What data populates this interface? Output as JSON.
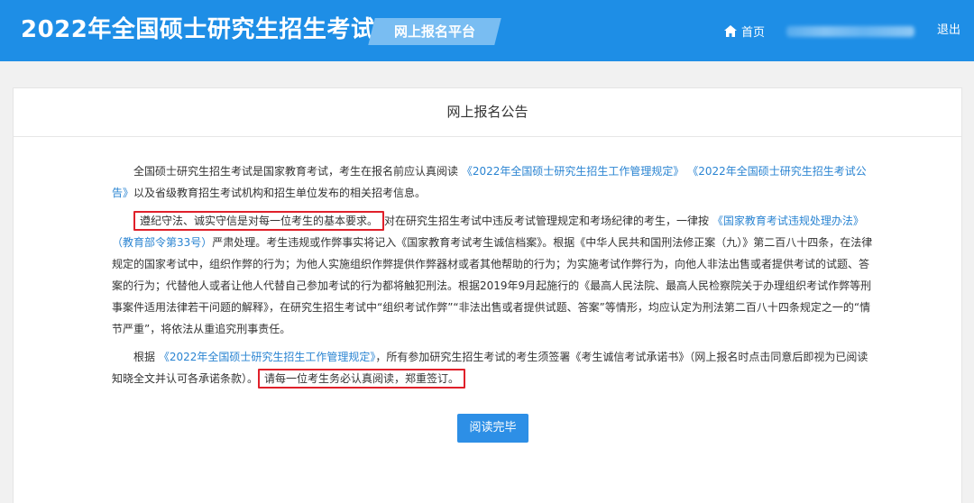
{
  "header": {
    "title": "2022年全国硕士研究生招生考试",
    "platform_badge": "网上报名平台",
    "nav": {
      "home_icon": "home-icon",
      "home_label": "首页",
      "logout_label": "退出"
    }
  },
  "panel": {
    "title": "网上报名公告",
    "paragraphs": [
      {
        "p1_a": "全国硕士研究生招生考试是国家教育考试，考生在报名前应认真阅读",
        "p1_link1": "《2022年全国硕士研究生招生工作管理规定》",
        "p1_link2": "《2022年全国硕士研究生招生考试公告》",
        "p1_b": "以及省级教育招生考试机构和招生单位发布的相关招考信息。"
      },
      {
        "p2_highlight": "遵纪守法、诚实守信是对每一位考生的基本要求。",
        "p2_a": "对在研究生招生考试中违反考试管理规定和考场纪律的考生，一律按",
        "p2_link": "《国家教育考试违规处理办法》（教育部令第33号）",
        "p2_b": "严肃处理。考生违规或作弊事实将记入《国家教育考试考生诚信档案》。根据《中华人民共和国刑法修正案（九）》第二百八十四条，在法律规定的国家考试中，组织作弊的行为；为他人实施组织作弊提供作弊器材或者其他帮助的行为；为实施考试作弊行为，向他人非法出售或者提供考试的试题、答案的行为；代替他人或者让他人代替自己参加考试的行为都将触犯刑法。根据2019年9月起施行的《最高人民法院、最高人民检察院关于办理组织考试作弊等刑事案件适用法律若干问题的解释》，在研究生招生考试中“组织考试作弊”“非法出售或者提供试题、答案”等情形，均应认定为刑法第二百八十四条规定之一的“情节严重”，将依法从重追究刑事责任。"
      },
      {
        "p3_a": "根据",
        "p3_link": "《2022年全国硕士研究生招生工作管理规定》",
        "p3_b": "，所有参加研究生招生考试的考生须签署《考生诚信考试承诺书》（网上报名时点击同意后即视为已阅读知晓全文并认可各承诺条款）。",
        "p3_highlight": "请每一位考生务必认真阅读，郑重签订。"
      }
    ],
    "read_button": "阅读完毕"
  },
  "colors": {
    "header_bg": "#1e8ee6",
    "badge_bg": "#79bdf2",
    "link": "#2a84d2",
    "highlight_border": "#e0202a",
    "button_bg": "#2d8fe6"
  }
}
